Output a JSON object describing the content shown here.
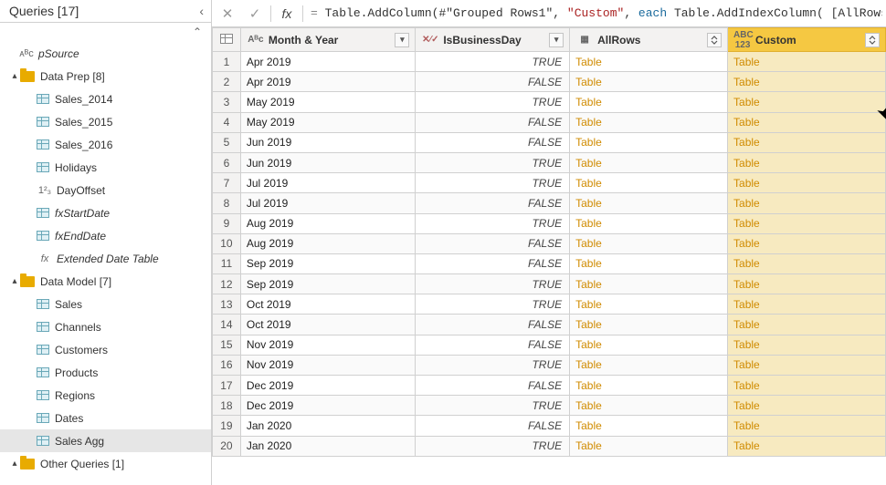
{
  "sidebar": {
    "title": "Queries [17]",
    "psource_label": "pSource",
    "groups": [
      {
        "name": "Data Prep [8]",
        "expanded": true,
        "items": [
          {
            "label": "Sales_2014",
            "icon": "table"
          },
          {
            "label": "Sales_2015",
            "icon": "table"
          },
          {
            "label": "Sales_2016",
            "icon": "table"
          },
          {
            "label": "Holidays",
            "icon": "table"
          },
          {
            "label": "DayOffset",
            "icon": "num"
          },
          {
            "label": "fxStartDate",
            "icon": "table",
            "italic": true
          },
          {
            "label": "fxEndDate",
            "icon": "table",
            "italic": true
          },
          {
            "label": "Extended Date Table",
            "icon": "fx",
            "italic": true
          }
        ]
      },
      {
        "name": "Data Model [7]",
        "expanded": true,
        "items": [
          {
            "label": "Sales",
            "icon": "table"
          },
          {
            "label": "Channels",
            "icon": "table"
          },
          {
            "label": "Customers",
            "icon": "table"
          },
          {
            "label": "Products",
            "icon": "table"
          },
          {
            "label": "Regions",
            "icon": "table"
          },
          {
            "label": "Dates",
            "icon": "table"
          },
          {
            "label": "Sales Agg",
            "icon": "table",
            "selected": true
          }
        ]
      },
      {
        "name": "Other Queries [1]",
        "expanded": true,
        "items": []
      }
    ]
  },
  "formula": {
    "prefix": "= ",
    "fn1": "Table.AddColumn",
    "arg1": "#\"Grouped Rows1\"",
    "arg2": "\"Custom\"",
    "kw_each": "each",
    "fn2": "Table.AddIndexColumn",
    "arg3": "[AllRows]"
  },
  "columns": {
    "month_year": "Month & Year",
    "is_business": "IsBusinessDay",
    "allrows": "AllRows",
    "custom": "Custom"
  },
  "link_value": "Table",
  "rows": [
    {
      "n": 1,
      "my": "Apr 2019",
      "ib": "TRUE"
    },
    {
      "n": 2,
      "my": "Apr 2019",
      "ib": "FALSE"
    },
    {
      "n": 3,
      "my": "May 2019",
      "ib": "TRUE"
    },
    {
      "n": 4,
      "my": "May 2019",
      "ib": "FALSE"
    },
    {
      "n": 5,
      "my": "Jun 2019",
      "ib": "FALSE"
    },
    {
      "n": 6,
      "my": "Jun 2019",
      "ib": "TRUE"
    },
    {
      "n": 7,
      "my": "Jul 2019",
      "ib": "TRUE"
    },
    {
      "n": 8,
      "my": "Jul 2019",
      "ib": "FALSE"
    },
    {
      "n": 9,
      "my": "Aug 2019",
      "ib": "TRUE"
    },
    {
      "n": 10,
      "my": "Aug 2019",
      "ib": "FALSE"
    },
    {
      "n": 11,
      "my": "Sep 2019",
      "ib": "FALSE"
    },
    {
      "n": 12,
      "my": "Sep 2019",
      "ib": "TRUE"
    },
    {
      "n": 13,
      "my": "Oct 2019",
      "ib": "TRUE"
    },
    {
      "n": 14,
      "my": "Oct 2019",
      "ib": "FALSE"
    },
    {
      "n": 15,
      "my": "Nov 2019",
      "ib": "FALSE"
    },
    {
      "n": 16,
      "my": "Nov 2019",
      "ib": "TRUE"
    },
    {
      "n": 17,
      "my": "Dec 2019",
      "ib": "FALSE"
    },
    {
      "n": 18,
      "my": "Dec 2019",
      "ib": "TRUE"
    },
    {
      "n": 19,
      "my": "Jan 2020",
      "ib": "FALSE"
    },
    {
      "n": 20,
      "my": "Jan 2020",
      "ib": "TRUE"
    }
  ]
}
